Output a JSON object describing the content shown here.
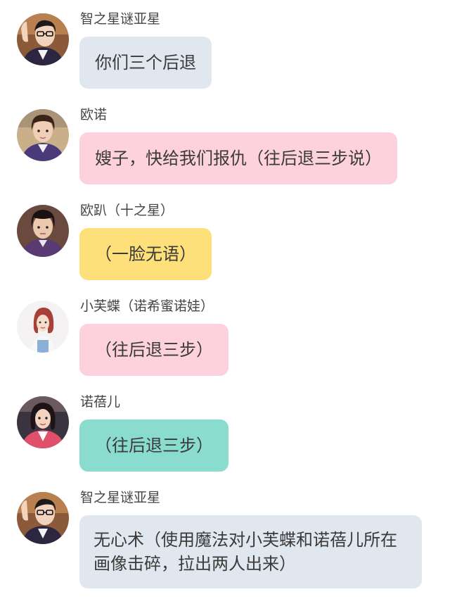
{
  "colors": {
    "gray_bubble": "#e1e7ef",
    "pink_bubble": "#fdd2dd",
    "yellow_bubble": "#fde07a",
    "teal_bubble": "#8adccf"
  },
  "messages": [
    {
      "sender": "智之星谜亚星",
      "text": "你们三个后退",
      "bubble_color": "#e1e7ef",
      "avatar_icon": "avatar-man-glasses-icon"
    },
    {
      "sender": "欧诺",
      "text": "嫂子，快给我们报仇（往后退三步说）",
      "bubble_color": "#fdd2dd",
      "avatar_icon": "avatar-boy-purple-icon"
    },
    {
      "sender": "欧趴（十之星）",
      "text": "（一脸无语）",
      "bubble_color": "#fde07a",
      "avatar_icon": "avatar-boy-dark-icon"
    },
    {
      "sender": "小芙蝶（诺希蜜诺娃）",
      "text": "（往后退三步）",
      "bubble_color": "#fdd2dd",
      "avatar_icon": "avatar-girl-redhair-icon"
    },
    {
      "sender": "诺蓓儿",
      "text": "（往后退三步）",
      "bubble_color": "#8adccf",
      "avatar_icon": "avatar-girl-pink-icon"
    },
    {
      "sender": "智之星谜亚星",
      "text": "无心术（使用魔法对小芙蝶和诺蓓儿所在画像击碎，拉出两人出来）",
      "bubble_color": "#e1e7ef",
      "avatar_icon": "avatar-man-glasses-icon"
    }
  ]
}
